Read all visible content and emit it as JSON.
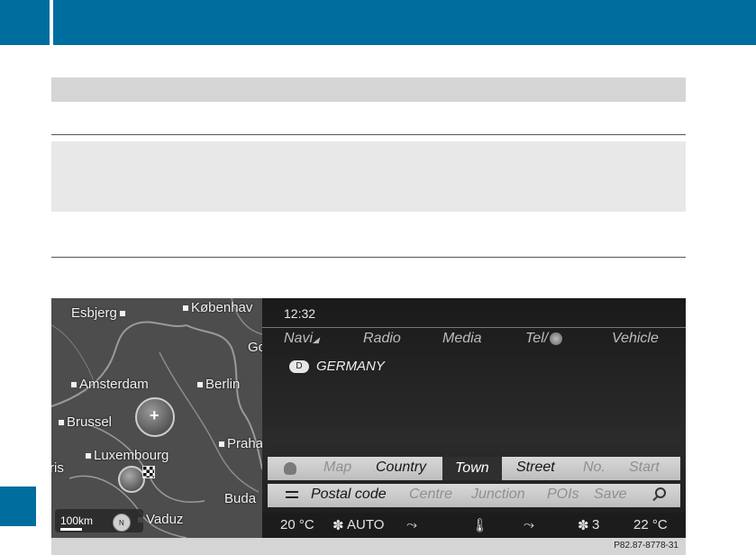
{
  "screen": {
    "time": "12:32",
    "main_menu": {
      "navi": "Navi",
      "radio": "Radio",
      "media": "Media",
      "tel": "Tel/",
      "vehicle": "Vehicle"
    },
    "country_code": "D",
    "country_name": "GERMANY",
    "menu_row_1": {
      "map": "Map",
      "country": "Country",
      "town": "Town",
      "street": "Street",
      "number": "No.",
      "start": "Start",
      "selected": "Town"
    },
    "menu_row_2": {
      "postal_code": "Postal code",
      "centre": "Centre",
      "junction": "Junction",
      "pois": "POIs",
      "save": "Save"
    },
    "climate": {
      "left_temp": "20 °C",
      "fan_mode": "AUTO",
      "fan_level": "3",
      "right_temp": "22 °C"
    },
    "map": {
      "cities": {
        "esbjerg": "Esbjerg",
        "kobenhavn": "Københav",
        "go": "Go",
        "amsterdam": "Amsterdam",
        "berlin": "Berlin",
        "brussel": "Brussel",
        "praha": "Praha",
        "luxembourg": "Luxembourg",
        "paris": "ris",
        "buda": "Buda",
        "vaduz": "Vaduz"
      },
      "scale": "100km",
      "compass": "N"
    }
  },
  "figure_code": "P82.87-8778-31",
  "colors": {
    "brand_blue": "#006d9f",
    "menu_bar": "#cfcfcf",
    "menu_selected": "#2f2f2f"
  }
}
